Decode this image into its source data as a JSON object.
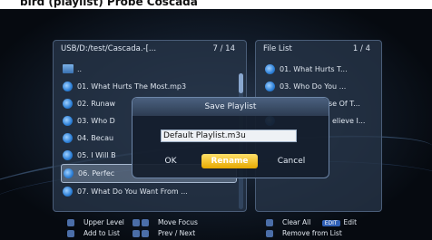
{
  "header": {
    "title": "bird (playlist) Probe Coscada"
  },
  "left_panel": {
    "path": "USB/D:/test/Cascada.-[...",
    "counter": "7 / 14",
    "items": [
      {
        "label": "..",
        "icon": "folder-icon"
      },
      {
        "label": "01. What Hurts The Most.mp3",
        "icon": "music-file-icon"
      },
      {
        "label": "02. Runaw",
        "icon": "music-file-icon"
      },
      {
        "label": "03. Who D",
        "icon": "music-file-icon"
      },
      {
        "label": "04. Becau",
        "icon": "music-file-icon"
      },
      {
        "label": "05. I Will B",
        "icon": "music-file-icon"
      },
      {
        "label": "06. Perfec",
        "icon": "music-file-icon",
        "selected": true
      },
      {
        "label": "07. What Do You Want From ...",
        "icon": "music-file-icon"
      }
    ]
  },
  "right_panel": {
    "title": "File List",
    "counter": "1 / 4",
    "items": [
      {
        "label": "01. What Hurts T...",
        "icon": "music-file-icon"
      },
      {
        "label": "03. Who Do You ...",
        "icon": "music-file-icon"
      },
      {
        "label": "se Of T...",
        "icon": "music-file-icon"
      },
      {
        "label": "elieve I...",
        "icon": "music-file-icon"
      }
    ]
  },
  "dialog": {
    "title": "Save Playlist",
    "field_value": "Default Playlist.m3u",
    "ok": "OK",
    "rename": "Rename",
    "cancel": "Cancel"
  },
  "footer": {
    "upper_level": "Upper Level",
    "add_to_list": "Add to List",
    "move_focus": "Move Focus",
    "prev_next": "Prev / Next",
    "clear_all": "Clear All",
    "edit_badge": "EDIT",
    "edit": "Edit",
    "remove_from_list": "Remove from List"
  },
  "colors": {
    "accent": "#ffd43a",
    "panel": "#263448",
    "dialog": "#141e2d"
  }
}
